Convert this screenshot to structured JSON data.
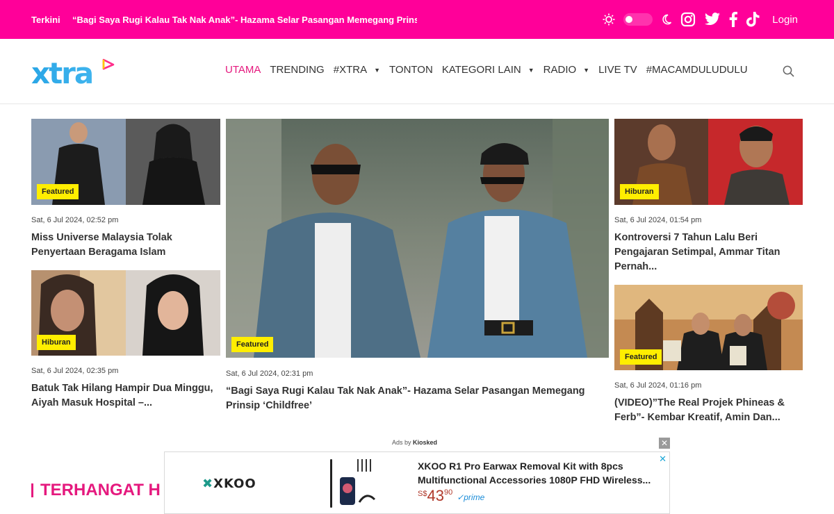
{
  "topbar": {
    "label": "Terkini",
    "ticker": "“Bagi Saya Rugi Kalau Tak Nak Anak”- Hazama Selar Pasangan Memegang Prinsip ‘Childfree’",
    "login": "Login",
    "icons": [
      "sun-icon",
      "theme-toggle",
      "moon-icon",
      "instagram-icon",
      "twitter-icon",
      "facebook-icon",
      "tiktok-icon"
    ]
  },
  "header": {
    "logo": "xtra",
    "nav": [
      {
        "label": "UTAMA",
        "active": true,
        "dropdown": false
      },
      {
        "label": "TRENDING",
        "active": false,
        "dropdown": false
      },
      {
        "label": "#XTRA",
        "active": false,
        "dropdown": true
      },
      {
        "label": "TONTON",
        "active": false,
        "dropdown": false
      },
      {
        "label": "KATEGORI LAIN",
        "active": false,
        "dropdown": true
      },
      {
        "label": "RADIO",
        "active": false,
        "dropdown": true
      },
      {
        "label": "LIVE TV",
        "active": false,
        "dropdown": false
      },
      {
        "label": "#MACAMDULUDULU",
        "active": false,
        "dropdown": false
      }
    ]
  },
  "articles": {
    "left1": {
      "badge": "Featured",
      "date": "Sat, 6 Jul 2024, 02:52 pm",
      "title": "Miss Universe Malaysia Tolak Penyertaan Beragama Islam"
    },
    "left2": {
      "badge": "Hiburan",
      "date": "Sat, 6 Jul 2024, 02:35 pm",
      "title": "Batuk Tak Hilang Hampir Dua Minggu, Aiyah Masuk Hospital –..."
    },
    "main": {
      "badge": "Featured",
      "date": "Sat, 6 Jul 2024, 02:31 pm",
      "title": "“Bagi Saya Rugi Kalau Tak Nak Anak”- Hazama Selar Pasangan Memegang Prinsip ‘Childfree’"
    },
    "right1": {
      "badge": "Hiburan",
      "date": "Sat, 6 Jul 2024, 01:54 pm",
      "title": "Kontroversi 7 Tahun Lalu Beri Pengajaran Setimpal, Ammar Titan Pernah..."
    },
    "right2": {
      "badge": "Featured",
      "date": "Sat, 6 Jul 2024, 01:16 pm",
      "title": "(VIDEO)”The Real Projek Phineas & Ferb”- Kembar Kreatif, Amin Dan..."
    }
  },
  "ad": {
    "ads_by_prefix": "Ads by",
    "ads_by_brand": "Kiosked",
    "brand": "XKOO",
    "product_title": "XKOO R1 Pro Earwax Removal Kit with 8pcs Multifunctional Accessories 1080P FHD Wireless...",
    "currency": "S$",
    "price": "43",
    "cents": "90",
    "prime": "✓prime"
  },
  "section": {
    "title": "TERHANGAT H"
  },
  "colors": {
    "brand_pink": "#ff0099",
    "badge_yellow": "#ffee00",
    "nav_active": "#e5197e"
  }
}
